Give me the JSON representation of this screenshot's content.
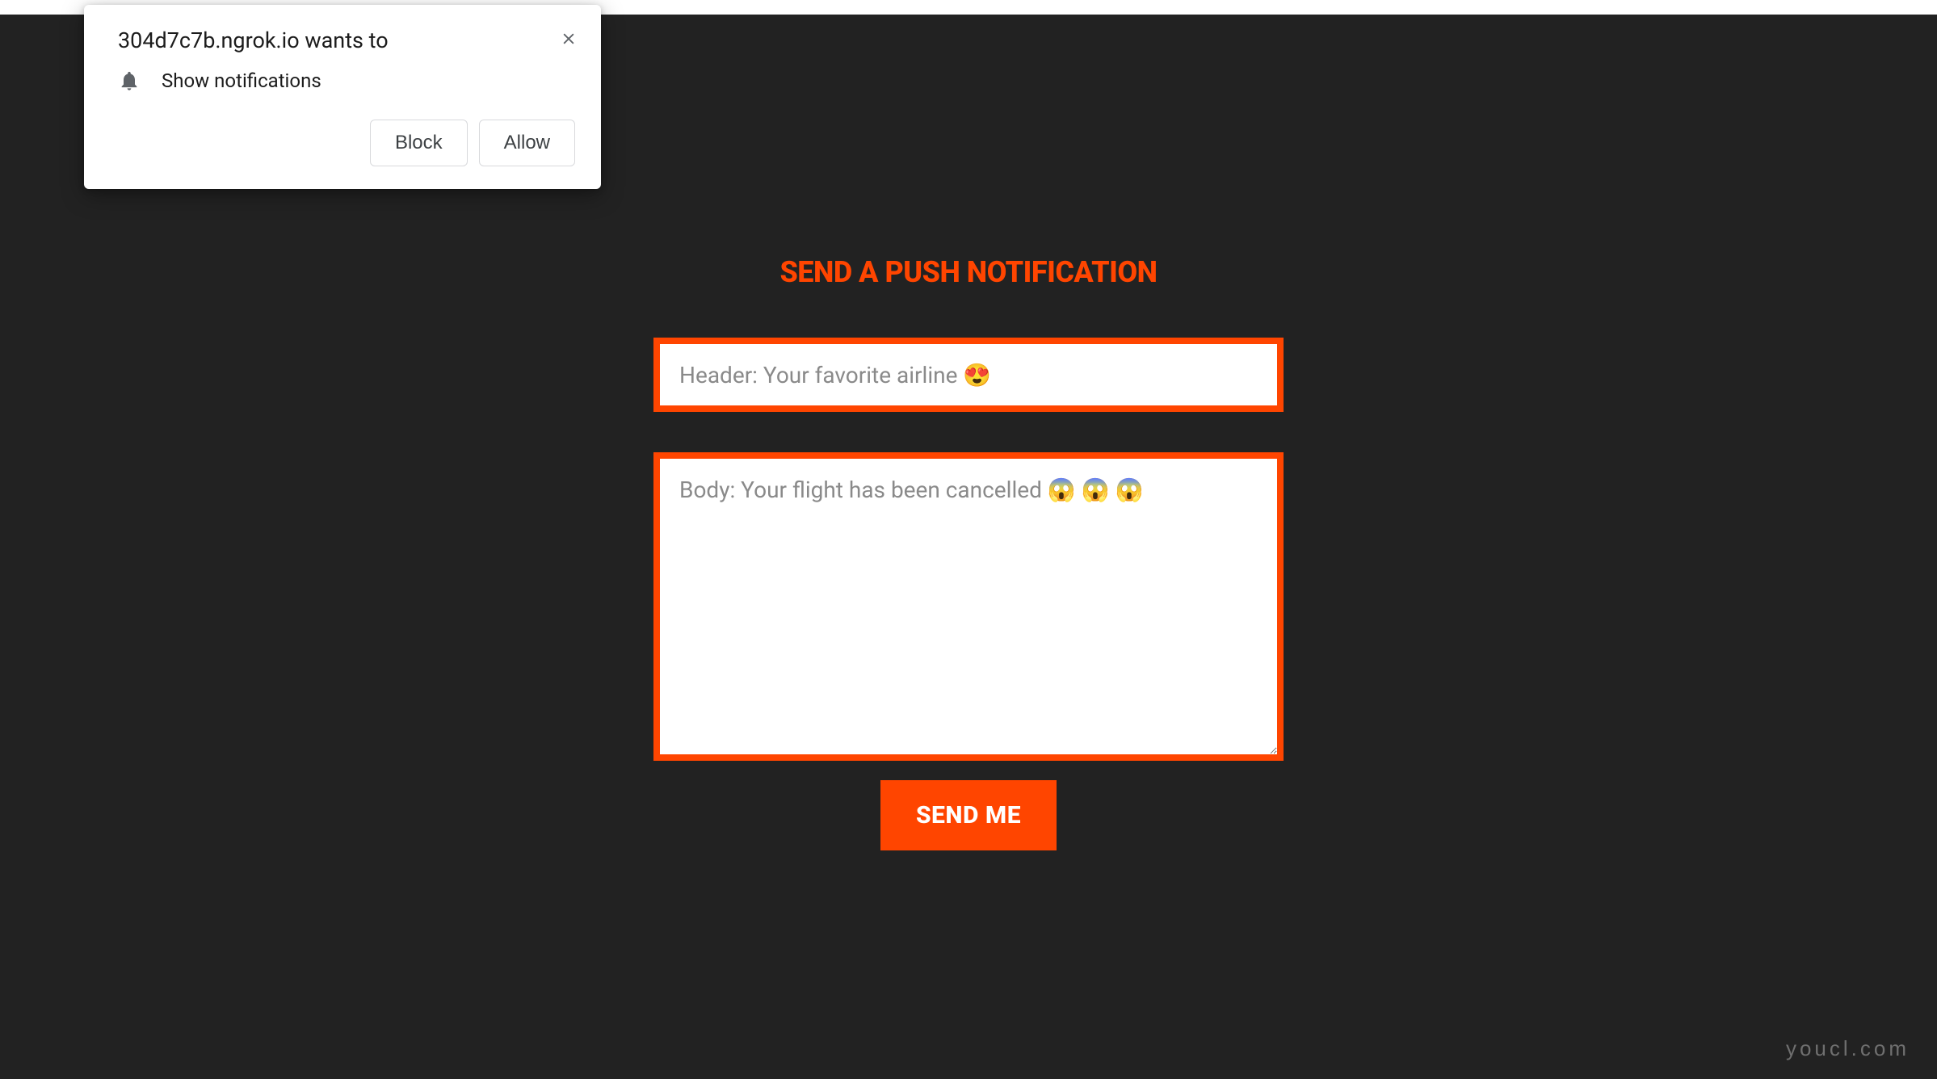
{
  "permission_prompt": {
    "origin": "304d7c7b.ngrok.io wants to",
    "description": "Show notifications",
    "block_label": "Block",
    "allow_label": "Allow"
  },
  "form": {
    "title": "SEND A PUSH NOTIFICATION",
    "header_placeholder": "Header: Your favorite airline 😍",
    "header_value": "",
    "body_placeholder": "Body: Your flight has been cancelled 😱 😱 😱",
    "body_value": "",
    "submit_label": "SEND ME"
  },
  "watermark": "youcl.com"
}
